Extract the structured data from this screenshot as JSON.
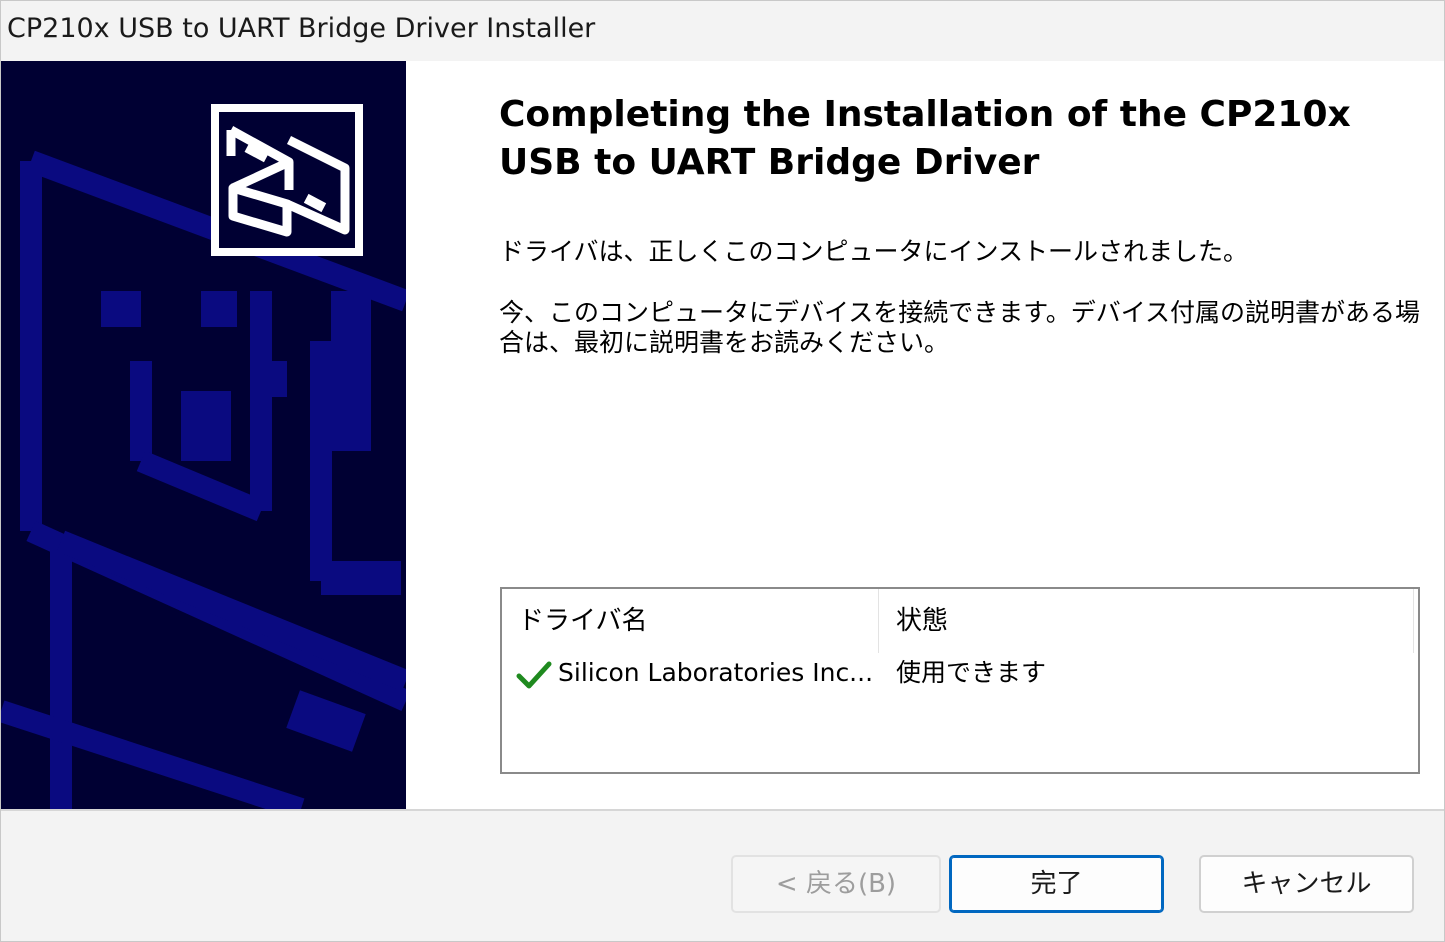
{
  "window": {
    "title": "CP210x USB to UART Bridge Driver Installer"
  },
  "main": {
    "heading": "Completing the Installation of the CP210x USB to UART Bridge Driver",
    "paragraph1": "ドライバは、正しくこのコンピュータにインストールされました。",
    "paragraph2": "今、このコンピュータにデバイスを接続できます。デバイス付属の説明書がある場合は、最初に説明書をお読みください。"
  },
  "driver_list": {
    "columns": [
      "ドライバ名",
      "状態"
    ],
    "rows": [
      {
        "name": "Silicon Laboratories Inc...",
        "status": "使用できます",
        "icon": "check-icon"
      }
    ]
  },
  "buttons": {
    "back": "< 戻る(B)",
    "finish": "完了",
    "cancel": "キャンセル"
  },
  "colors": {
    "banner_bg": "#000033",
    "banner_pattern": "#0a0a80",
    "check": "#1f8a1f",
    "accent": "#0067c0"
  }
}
